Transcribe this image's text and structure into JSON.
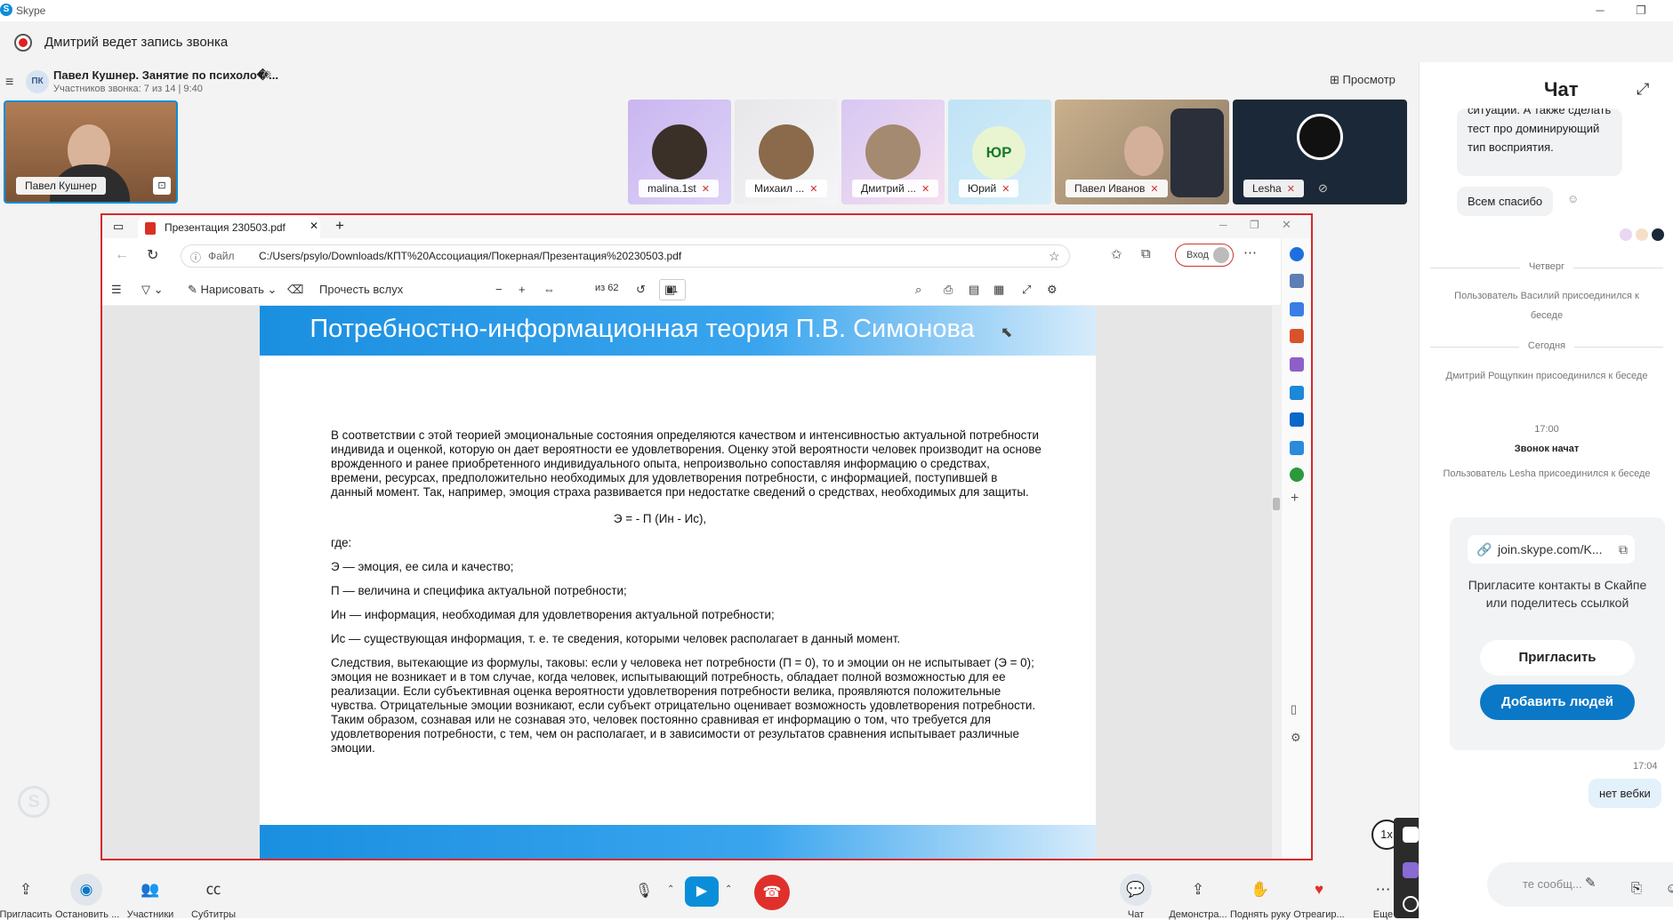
{
  "app": {
    "title": "Skype",
    "icon": "skype-logo-icon"
  },
  "recording": {
    "text": "Дмитрий ведет запись звонка"
  },
  "call": {
    "avatar_initials": "ПК",
    "title": "Павел Кушнер. Занятие по психоло�...",
    "subtitle": "Участников звонка: 7 из 14 | 9:40",
    "preview_label": "Просмотр"
  },
  "self_tile": {
    "name": "Павел Кушнер"
  },
  "participants": [
    {
      "name": "malina.1st"
    },
    {
      "name": "Михаил ..."
    },
    {
      "name": "Дмитрий ..."
    },
    {
      "name": "Юрий",
      "initials": "ЮР"
    },
    {
      "name": "Павел Иванов"
    },
    {
      "name": "Lesha"
    }
  ],
  "browser": {
    "tab_title": "Презентация 230503.pdf",
    "url_prefix": "Файл",
    "url": "C:/Users/psylo/Downloads/КПТ%20Ассоциация/Покерная/Презентация%20230503.pdf",
    "signin": "Вход",
    "toolbar": {
      "draw": "Нарисовать",
      "read_aloud": "Прочесть вслух",
      "page": "21",
      "of": "из 62"
    }
  },
  "slide": {
    "title": "Потребностно-информационная теория П.В. Симонова",
    "para1": "В соответствии с этой теорией эмоциональные состояния определяются качеством и интенсивностью актуальной потребности индивида и оценкой, которую он дает вероятности ее удовлетворения. Оценку этой вероятности человек производит на основе врожденного и ранее приобретенного индивидуального опыта, непроизвольно сопоставляя информацию о средствах, времени, ресурсах, предположительно необходимых для удовлетворения потребности, с информацией, поступившей в данный момент. Так, например, эмоция страха развивается при недостатке сведений о средствах, необходимых для защиты.",
    "formula": "Э = - П (Ин - Ис),",
    "where": "где:",
    "def1": "Э — эмоция, ее сила и качество;",
    "def2": "П — величина и специфика актуальной потребности;",
    "def3": "Ин — информация, необходимая для удовлетворения актуальной потребности;",
    "def4": "Ис — существующая информация, т. е. те сведения, которыми человек располагает в данный момент.",
    "para2": "Следствия, вытекающие из формулы, таковы: если у человека нет потребности (П = 0), то и эмоции он не испытывает (Э = 0); эмоция не возникает и в том случае, когда человек, испытывающий потребность, обладает полной возможностью для ее реализации. Если субъективная оценка вероятности удовлетворения потребности велика, проявляются положительные чувства. Отрицательные эмоции возникают, если субъект отрицательно оценивает возможность удовлетворения потребности. Таким образом, сознавая или не сознавая это, человек постоянно сравнивая ет информацию о том, что требуется для удовлетворения потребности, с тем, чем он располагает, и в зависимости от результатов сравнения испытывает различные эмоции."
  },
  "controls": {
    "invite": "Пригласить",
    "stop": "Остановить ...",
    "participants": "Участники",
    "subtitles": "Субтитры",
    "chat": "Чат",
    "share": "Демонстра...",
    "raise_hand": "Поднять руку",
    "react": "Отреагир...",
    "more": "Еще",
    "speed": "1x"
  },
  "chat": {
    "title": "Чат",
    "msg1": "ситуации. А также сделать тест про доминирующий тип восприятия.",
    "msg2": "Всем спасибо",
    "day1": "Четверг",
    "sys1": "Пользователь Василий присоединился к беседе",
    "day2": "Сегодня",
    "sys2": "Дмитрий Рощупкин присоединился к беседе",
    "time1": "17:00",
    "call_started": "Звонок начат",
    "sys3": "Пользователь Lesha присоединился к беседе",
    "invite_link": "join.skype.com/K...",
    "invite_text": "Пригласите контакты в Скайпе или поделитесь ссылкой",
    "invite_btn": "Пригласить",
    "add_btn": "Добавить людей",
    "time2": "17:04",
    "msg3": "нет вебки",
    "input_placeholder": "те сообщ..."
  },
  "colors": {
    "accent": "#0a78c7",
    "record": "#e02020",
    "end_call": "#e0302c",
    "share_border": "#d52a2a"
  }
}
